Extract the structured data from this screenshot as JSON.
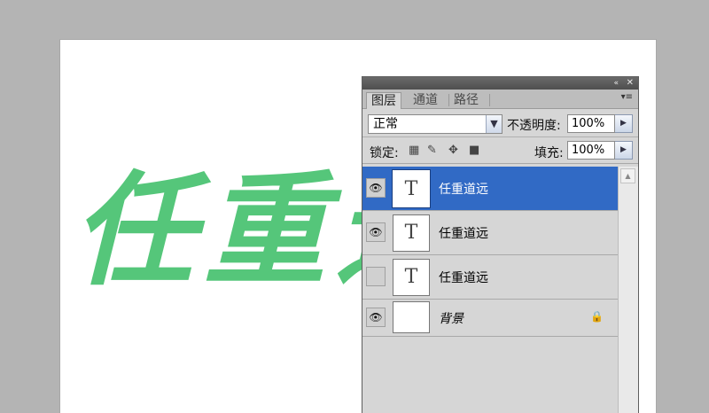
{
  "canvas": {
    "text": "任重道远",
    "text_color": "#55c67a"
  },
  "panel": {
    "titlebar": {
      "collapse_icon": "«",
      "close_icon": "✕"
    },
    "tabs": [
      {
        "label": "图层",
        "active": true
      },
      {
        "label": "通道",
        "active": false
      },
      {
        "label": "路径",
        "active": false
      }
    ],
    "menu_icon": "▾≡",
    "blend_mode": "正常",
    "opacity_label": "不透明度:",
    "opacity_value": "100%",
    "lock_label": "锁定:",
    "fill_label": "填充:",
    "fill_value": "100%",
    "layers": [
      {
        "name": "任重道远",
        "thumb": "T",
        "visible": true,
        "selected": true
      },
      {
        "name": "任重道远",
        "thumb": "T",
        "visible": true,
        "selected": false
      },
      {
        "name": "任重道远",
        "thumb": "T",
        "visible": false,
        "selected": false
      },
      {
        "name": "背景",
        "thumb": "",
        "visible": true,
        "selected": false,
        "locked": true
      }
    ],
    "selected_color": "#316ac5"
  }
}
